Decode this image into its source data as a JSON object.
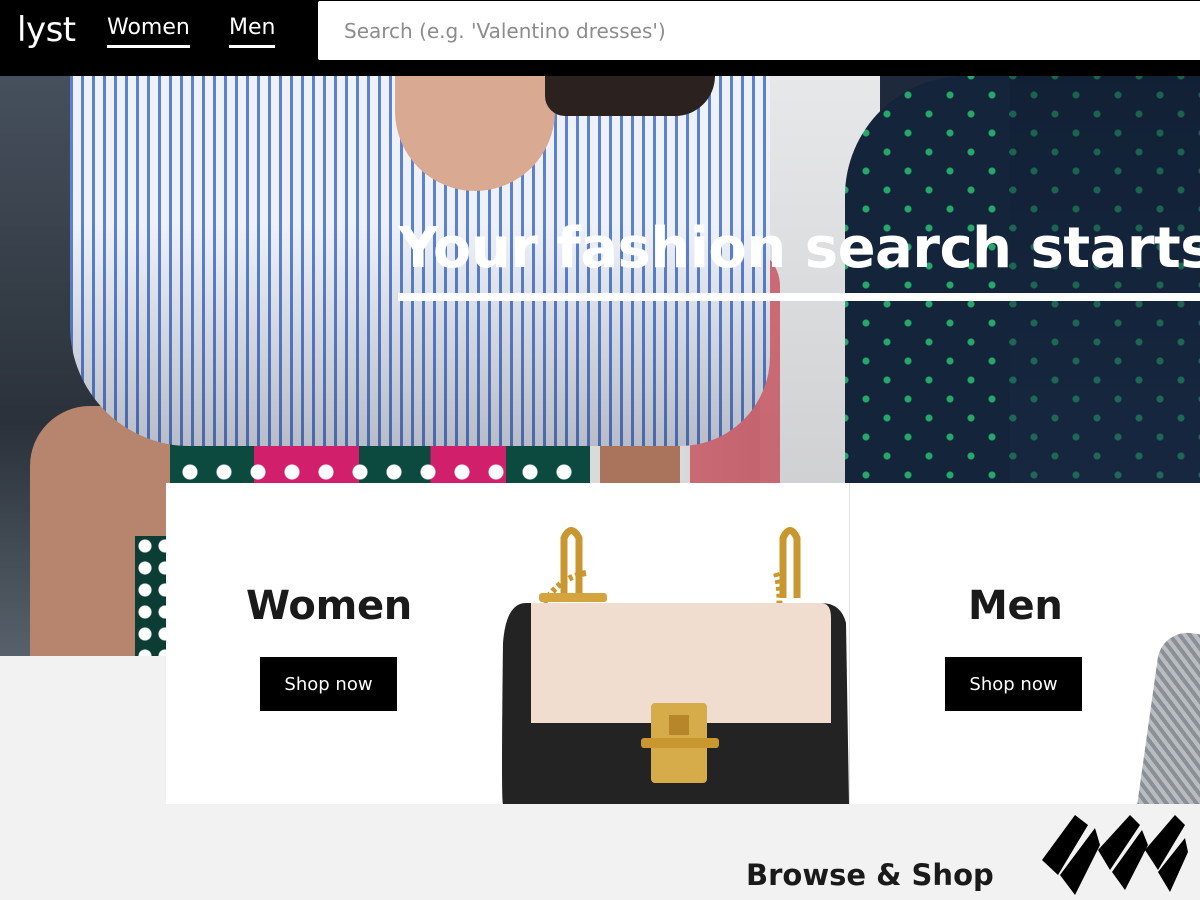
{
  "header": {
    "logo": "lyst",
    "nav": [
      {
        "label": "Women"
      },
      {
        "label": "Men"
      }
    ],
    "search_placeholder": "Search (e.g. 'Valentino dresses')"
  },
  "hero": {
    "headline": "Your fashion search starts h"
  },
  "categories": [
    {
      "title": "Women",
      "button": "Shop now"
    },
    {
      "title": "Men",
      "button": "Shop now"
    }
  ],
  "browse": {
    "heading": "Browse & Shop"
  },
  "colors": {
    "nav_background": "#000000",
    "button_background": "#000000",
    "page_background": "#f2f2f2"
  }
}
